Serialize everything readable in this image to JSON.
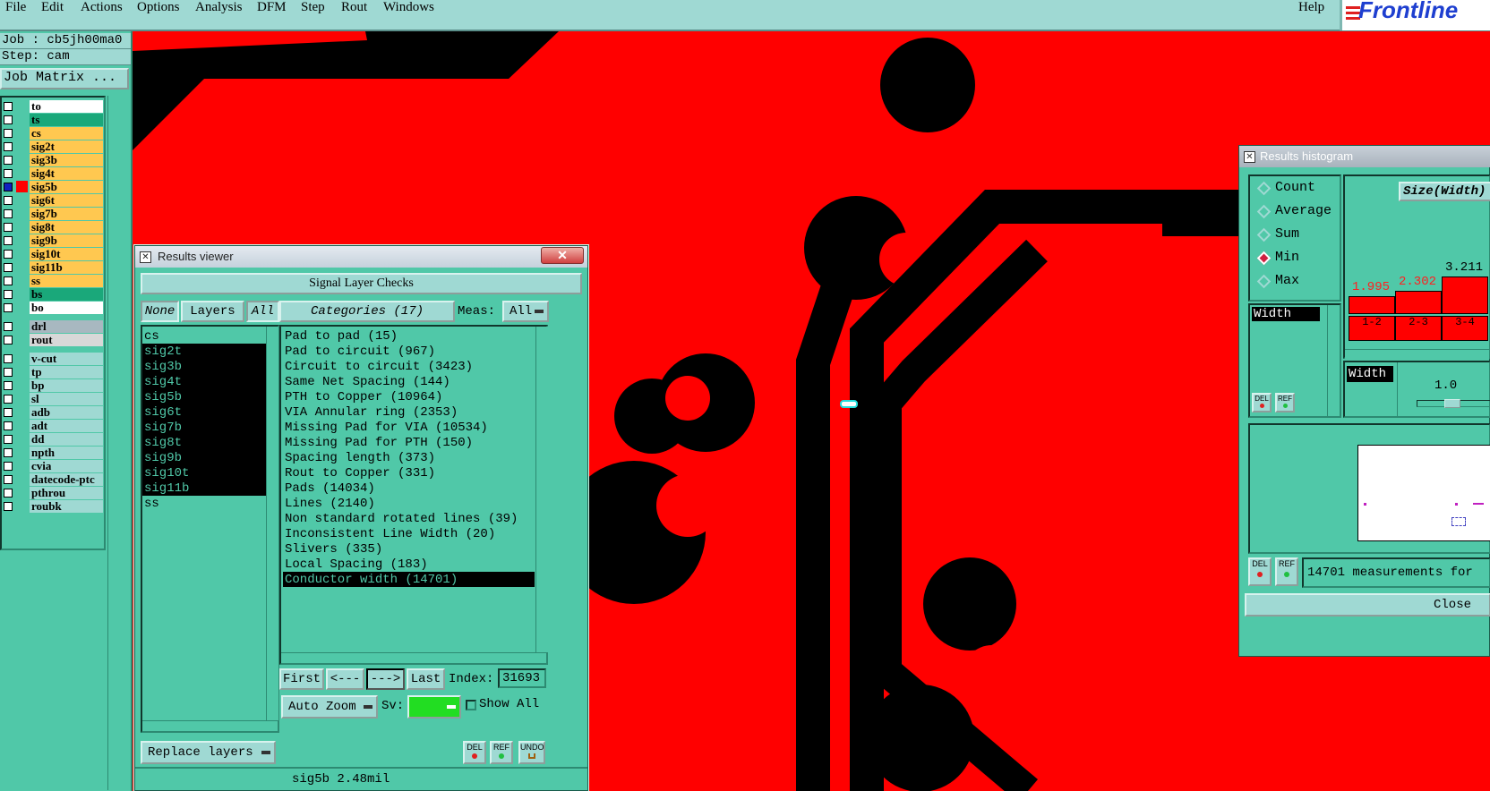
{
  "menubar": {
    "items": [
      "File",
      "Edit",
      "Actions",
      "Options",
      "Analysis",
      "DFM",
      "Step",
      "Rout",
      "Windows"
    ],
    "help": "Help",
    "brand": "Frontline"
  },
  "job": {
    "job_label": "Job : cb5jh00ma0",
    "step_label": "Step: cam",
    "job_matrix": "Job Matrix ..."
  },
  "layers": {
    "group1": [
      {
        "name": "to",
        "color": "#ffffff"
      },
      {
        "name": "ts",
        "color": "#1aa87a"
      },
      {
        "name": "cs",
        "color": "#ffc850"
      },
      {
        "name": "sig2t",
        "color": "#ffc850"
      },
      {
        "name": "sig3b",
        "color": "#ffc850"
      },
      {
        "name": "sig4t",
        "color": "#ffc850"
      },
      {
        "name": "sig5b",
        "color": "#ffc850"
      },
      {
        "name": "sig6t",
        "color": "#ffc850"
      },
      {
        "name": "sig7b",
        "color": "#ffc850"
      },
      {
        "name": "sig8t",
        "color": "#ffc850"
      },
      {
        "name": "sig9b",
        "color": "#ffc850"
      },
      {
        "name": "sig10t",
        "color": "#ffc850"
      },
      {
        "name": "sig11b",
        "color": "#ffc850"
      },
      {
        "name": "ss",
        "color": "#ffc850"
      },
      {
        "name": "bs",
        "color": "#1aa87a"
      },
      {
        "name": "bo",
        "color": "#ffffff"
      }
    ],
    "group2": [
      {
        "name": "drl",
        "color": "#a8b8c0"
      },
      {
        "name": "rout",
        "color": "#d8d8d8"
      }
    ],
    "group3": [
      {
        "name": "v-cut",
        "color": "#9fd9d3"
      },
      {
        "name": "tp",
        "color": "#9fd9d3"
      },
      {
        "name": "bp",
        "color": "#9fd9d3"
      },
      {
        "name": "sl",
        "color": "#9fd9d3"
      },
      {
        "name": "adb",
        "color": "#9fd9d3"
      },
      {
        "name": "adt",
        "color": "#9fd9d3"
      },
      {
        "name": "dd",
        "color": "#9fd9d3"
      },
      {
        "name": "npth",
        "color": "#9fd9d3"
      },
      {
        "name": "cvia",
        "color": "#9fd9d3"
      },
      {
        "name": "datecode-ptc",
        "color": "#9fd9d3"
      },
      {
        "name": "pthrou",
        "color": "#9fd9d3"
      },
      {
        "name": "roubk",
        "color": "#9fd9d3"
      }
    ]
  },
  "results_viewer": {
    "title": "Results viewer",
    "close_glyph": "✕",
    "header": "Signal Layer Checks",
    "none_btn": "None",
    "layers_btn": "Layers",
    "all_btn": "All",
    "categories_btn": "Categories (17)",
    "meas_label": "Meas:",
    "meas_value": "All",
    "layer_list": [
      {
        "name": "cs",
        "selected": false
      },
      {
        "name": "sig2t",
        "selected": true
      },
      {
        "name": "sig3b",
        "selected": true
      },
      {
        "name": "sig4t",
        "selected": true
      },
      {
        "name": "sig5b",
        "selected": true
      },
      {
        "name": "sig6t",
        "selected": true
      },
      {
        "name": "sig7b",
        "selected": true
      },
      {
        "name": "sig8t",
        "selected": true
      },
      {
        "name": "sig9b",
        "selected": true
      },
      {
        "name": "sig10t",
        "selected": true
      },
      {
        "name": "sig11b",
        "selected": true
      },
      {
        "name": "ss",
        "selected": false
      }
    ],
    "categories": [
      {
        "label": "Pad to pad (15)",
        "selected": false
      },
      {
        "label": "Pad to circuit (967)",
        "selected": false
      },
      {
        "label": "Circuit to circuit (3423)",
        "selected": false
      },
      {
        "label": "Same Net Spacing (144)",
        "selected": false
      },
      {
        "label": "PTH to Copper (10964)",
        "selected": false
      },
      {
        "label": "VIA Annular ring (2353)",
        "selected": false
      },
      {
        "label": "Missing Pad for VIA (10534)",
        "selected": false
      },
      {
        "label": "Missing Pad for PTH (150)",
        "selected": false
      },
      {
        "label": "Spacing length (373)",
        "selected": false
      },
      {
        "label": "Rout to Copper (331)",
        "selected": false
      },
      {
        "label": "Pads (14034)",
        "selected": false
      },
      {
        "label": "Lines (2140)",
        "selected": false
      },
      {
        "label": "Non standard rotated lines (39)",
        "selected": false
      },
      {
        "label": "Inconsistent Line Width (20)",
        "selected": false
      },
      {
        "label": "Slivers (335)",
        "selected": false
      },
      {
        "label": "Local Spacing (183)",
        "selected": false
      },
      {
        "label": "Conductor width (14701)",
        "selected": true
      }
    ],
    "first_btn": "First",
    "prev_btn": "<---",
    "next_btn": "--->",
    "last_btn": "Last",
    "index_label": "Index:",
    "index_value": "31693",
    "auto_zoom_btn": "Auto Zoom",
    "sv_label": "Sv:",
    "sv_color": "#22dd22",
    "show_all_label": "Show All",
    "replace_layers_btn": "Replace layers",
    "del_btn": "DEL",
    "ref_btn": "REF",
    "undo_btn": "UNDO",
    "status": "sig5b 2.48mil"
  },
  "histogram": {
    "title": "Results histogram",
    "close_glyph": "✕",
    "modes": [
      {
        "label": "Count",
        "selected": false
      },
      {
        "label": "Average",
        "selected": false
      },
      {
        "label": "Sum",
        "selected": false
      },
      {
        "label": "Min",
        "selected": true
      },
      {
        "label": "Max",
        "selected": false
      }
    ],
    "field_selected": "Width",
    "chart_title": "Size(Width)",
    "bins": [
      {
        "label": "1-2",
        "value": 1.995,
        "value_text": "1.995"
      },
      {
        "label": "2-3",
        "value": 2.302,
        "value_text": "2.302"
      },
      {
        "label": "3-4",
        "value": 3.211,
        "value_text": "3.211"
      }
    ],
    "slider_field": "Width",
    "slider_value": "1.0",
    "measurements_text": "14701 measurements for",
    "del_btn": "DEL",
    "ref_btn": "REF",
    "close_btn": "Close"
  }
}
